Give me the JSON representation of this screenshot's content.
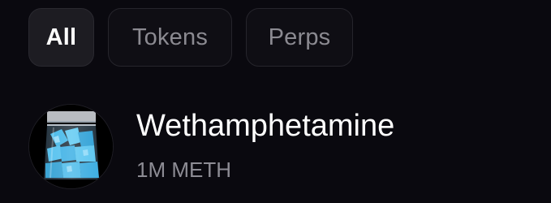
{
  "filters": {
    "tabs": [
      {
        "label": "All",
        "selected": true
      },
      {
        "label": "Tokens",
        "selected": false
      },
      {
        "label": "Perps",
        "selected": false
      }
    ]
  },
  "token": {
    "name": "Wethamphetamine",
    "amount": "1M METH",
    "avatar_icon": "crystal-bag-icon"
  },
  "colors": {
    "background": "#0a090f",
    "tab_selected_bg": "#1d1c22",
    "tab_text": "#8b8a91",
    "primary_text": "#ffffff",
    "secondary_text": "#8d8c94",
    "crystal_blue": "#3fb6e8"
  }
}
